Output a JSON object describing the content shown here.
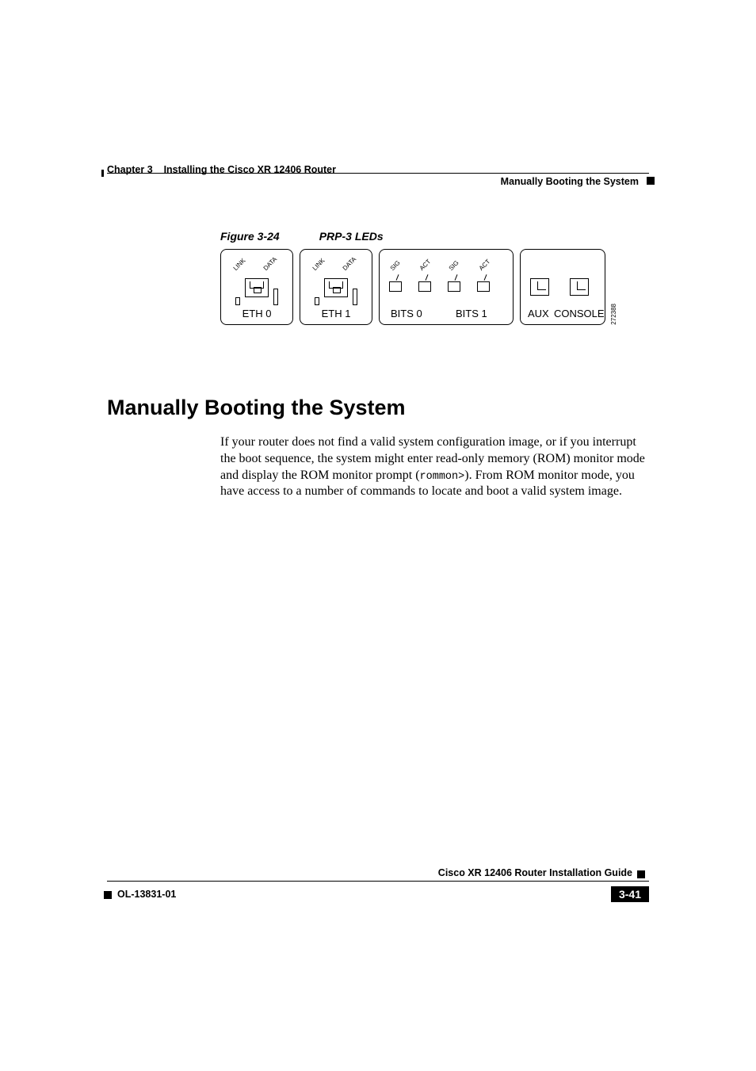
{
  "header": {
    "chapter_label": "Chapter 3",
    "chapter_title": "Installing the Cisco XR 12406 Router",
    "section_title": "Manually Booting the System"
  },
  "figure": {
    "number": "Figure 3-24",
    "title": "PRP-3 LEDs",
    "image_id": "272388",
    "eth0": {
      "led1": "LINK",
      "led2": "DATA",
      "label": "ETH 0"
    },
    "eth1": {
      "led1": "LINK",
      "led2": "DATA",
      "label": "ETH 1"
    },
    "bits": {
      "led1": "SIG",
      "led2": "ACT",
      "led3": "SIG",
      "led4": "ACT",
      "label1": "BITS 0",
      "label2": "BITS 1"
    },
    "aux": {
      "label1": "AUX",
      "label2": "CONSOLE"
    }
  },
  "section": {
    "heading": "Manually Booting the System",
    "body_pre": "If your router does not find a valid system configuration image, or if you interrupt the boot sequence, the system might enter read-only memory (ROM) monitor mode and display the ROM monitor prompt (",
    "rommon": "rommon>",
    "body_post": "). From ROM monitor mode, you have access to a number of commands to locate and boot a valid system image."
  },
  "footer": {
    "guide_title": "Cisco XR 12406 Router Installation Guide",
    "doc_number": "OL-13831-01",
    "page_number": "3-41"
  }
}
